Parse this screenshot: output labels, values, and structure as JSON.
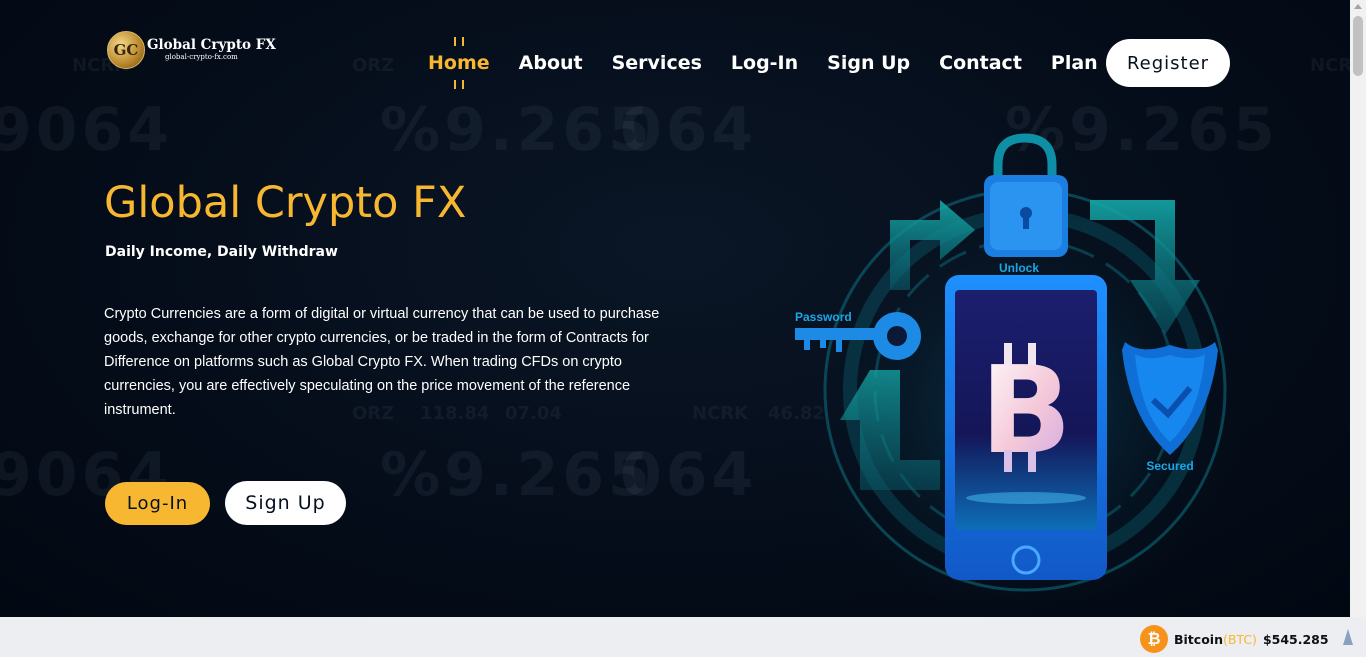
{
  "brand": {
    "logo_mark": "GC",
    "name": "Global Crypto FX",
    "url": "global-crypto-fx.com"
  },
  "nav": {
    "items": [
      {
        "label": "Home",
        "active": true
      },
      {
        "label": "About",
        "active": false
      },
      {
        "label": "Services",
        "active": false
      },
      {
        "label": "Log-In",
        "active": false
      },
      {
        "label": "Sign Up",
        "active": false
      },
      {
        "label": "Contact",
        "active": false
      },
      {
        "label": "Plan",
        "active": false
      }
    ],
    "register_label": "Register"
  },
  "hero": {
    "title": "Global Crypto FX",
    "subtitle": "Daily Income, Daily Withdraw",
    "description": "Crypto Currencies are a form of digital or virtual currency that can be used to purchase goods, exchange for other crypto currencies, or be traded in the form of Contracts for Difference on platforms such as Global Crypto FX. When trading CFDs on crypto currencies, you are effectively speculating on the price movement of the reference instrument.",
    "login_label": "Log-In",
    "signup_label": "Sign Up"
  },
  "illustration": {
    "unlock_label": "Unlock",
    "password_label": "Password",
    "secured_label": "Secured",
    "coin_symbol": "B"
  },
  "background_text": {
    "big_1": "9064",
    "big_2": "%9.265",
    "big_3": "064",
    "small_1": "NCRK",
    "small_2": "ORZ",
    "small_3": "118.84",
    "small_4": "07.04",
    "small_5": "46.82"
  },
  "ticker": {
    "coin_icon": "₿",
    "name": "Bitcoin",
    "symbol": "(BTC)",
    "price": "$545.285"
  },
  "colors": {
    "accent": "#f7b731",
    "background": "#030b17",
    "ticker_bg": "#eceef1",
    "btc": "#f7931a"
  }
}
